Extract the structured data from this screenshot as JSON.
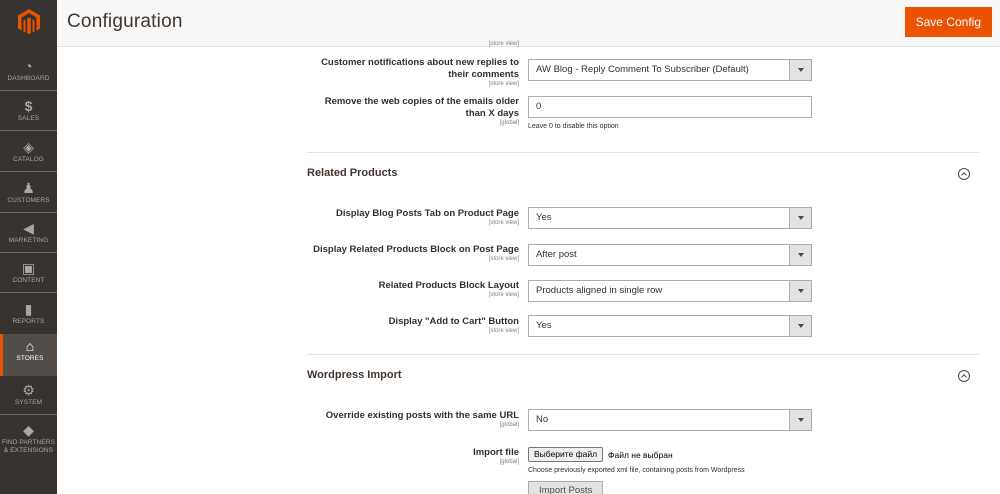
{
  "header": {
    "title": "Configuration",
    "save_label": "Save Config"
  },
  "sidebar": {
    "items": [
      {
        "label": "DASHBOARD",
        "icon": "dashboard-icon",
        "glyph": "◔"
      },
      {
        "label": "SALES",
        "icon": "dollar-icon",
        "glyph": "$"
      },
      {
        "label": "CATALOG",
        "icon": "box-icon",
        "glyph": "◈"
      },
      {
        "label": "CUSTOMERS",
        "icon": "person-icon",
        "glyph": "♟"
      },
      {
        "label": "MARKETING",
        "icon": "megaphone-icon",
        "glyph": "◀"
      },
      {
        "label": "CONTENT",
        "icon": "layout-icon",
        "glyph": "▣"
      },
      {
        "label": "REPORTS",
        "icon": "bar-chart-icon",
        "glyph": "▮"
      },
      {
        "label": "STORES",
        "icon": "store-icon",
        "glyph": "⌂"
      },
      {
        "label": "SYSTEM",
        "icon": "gear-icon",
        "glyph": "⚙"
      },
      {
        "label1": "FIND PARTNERS",
        "label2": "& EXTENSIONS",
        "icon": "cube-icon",
        "glyph": "◆"
      }
    ]
  },
  "scope": {
    "store_view": "[store view]",
    "global": "[global]"
  },
  "top": {
    "notif_label_1": "Customer notifications about new replies to",
    "notif_label_2": "their comments",
    "notif_value": "AW Blog - Reply Comment To Subscriber (Default)",
    "remove_label_1": "Remove the web copies of the emails older",
    "remove_label_2": "than X days",
    "remove_value": "0",
    "remove_note": "Leave 0 to disable this option"
  },
  "related": {
    "title": "Related Products",
    "tab_label": "Display Blog Posts Tab on Product Page",
    "tab_value": "Yes",
    "block_label": "Display Related Products Block on Post Page",
    "block_value": "After post",
    "layout_label": "Related Products Block Layout",
    "layout_value": "Products aligned in single row",
    "cart_label": "Display \"Add to Cart\" Button",
    "cart_value": "Yes"
  },
  "wordpress": {
    "title": "Wordpress Import",
    "override_label": "Override existing posts with the same URL",
    "override_value": "No",
    "file_label": "Import file",
    "file_button": "Выберите файл",
    "file_status": "Файл не выбран",
    "file_note": "Choose previously exported xml file, containing posts from Wordpress",
    "import_button": "Import Posts"
  },
  "colors": {
    "accent": "#eb5202",
    "sidebar_bg": "#373330"
  }
}
